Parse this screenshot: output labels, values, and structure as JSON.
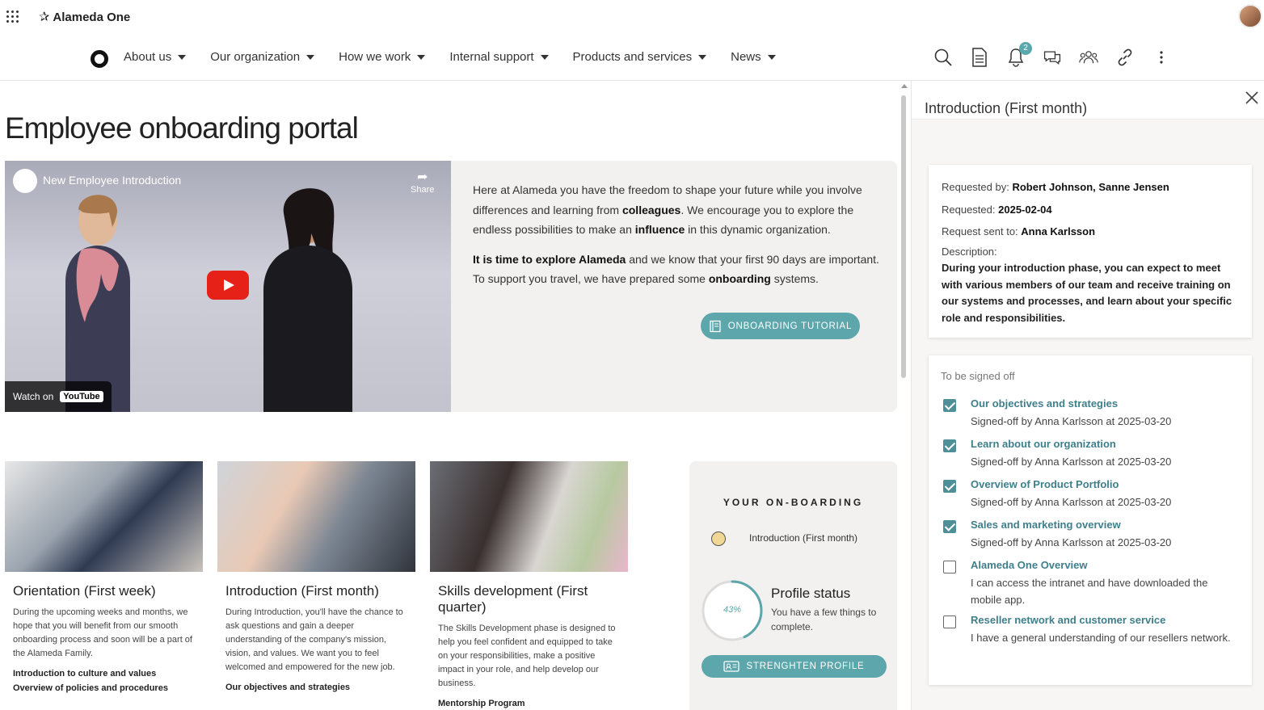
{
  "brand": {
    "name": "Alameda One"
  },
  "nav": {
    "items": [
      {
        "label": "About us"
      },
      {
        "label": "Our organization"
      },
      {
        "label": "How we work"
      },
      {
        "label": "Internal support"
      },
      {
        "label": "Products and services"
      },
      {
        "label": "News"
      }
    ],
    "icons": [
      "search-icon",
      "document-icon",
      "bell-icon",
      "chat-icon",
      "people-icon",
      "link-icon",
      "more-vertical-icon"
    ],
    "notification_count": "2"
  },
  "page": {
    "title": "Employee onboarding portal"
  },
  "video": {
    "title": "New Employee Introduction",
    "share_label": "Share",
    "watch_on": "Watch on",
    "youtube_label": "YouTube"
  },
  "hero": {
    "p1_a": "Here at Alameda you have the freedom to shape your future while you involve differences and learning from ",
    "p1_b": "colleagues",
    "p1_c": ". We encourage you to explore the endless possibilities to make an ",
    "p1_d": "influence",
    "p1_e": " in this dynamic organization.",
    "p2_a": "It is time to explore Alameda",
    "p2_b": " and we know that your first 90 days are important. To support you travel, we have prepared some ",
    "p2_c": "onboarding",
    "p2_d": " systems.",
    "tutorial_button": "ONBOARDING TUTORIAL"
  },
  "cards": [
    {
      "title": "Orientation (First week)",
      "text": "During the upcoming weeks and months, we hope that you will benefit from our smooth onboarding process and soon will be a part of the Alameda Family.",
      "links": [
        "Introduction to culture and values",
        "Overview of policies and procedures"
      ]
    },
    {
      "title": "Introduction (First month)",
      "text": "During Introduction, you'll have the chance to ask questions and gain a deeper understanding of the company's mission, vision, and values. We want you to feel welcomed and empowered for the new job.",
      "links": [
        "Our objectives and strategies"
      ]
    },
    {
      "title": "Skills development (First quarter)",
      "text": "The Skills Development phase is designed to help you feel confident and equipped to take on your responsibilities, make a positive impact in your role, and help develop our business.",
      "links": [
        "Mentorship Program"
      ]
    }
  ],
  "onboarding": {
    "title": "YOUR ON-BOARDING",
    "current_phase": "Introduction (First month)",
    "progress_percent": 43,
    "progress_label": "43%",
    "profile_title": "Profile status",
    "profile_desc": "You have a few things to complete.",
    "strengthen_button": "STRENGHTEN PROFILE"
  },
  "panel": {
    "title": "Introduction (First month)",
    "requested_by_label": "Requested by:",
    "requested_by": "Robert Johnson, Sanne Jensen",
    "requested_label": "Requested:",
    "requested": "2025-02-04",
    "sent_to_label": "Request sent to:",
    "sent_to": "Anna Karlsson",
    "description_label": "Description:",
    "description": "During your introduction phase, you can expect to meet with various members of our team and receive training on our systems and processes, and learn about your specific role and responsibilities.",
    "signoff_heading": "To be signed off",
    "items": [
      {
        "title": "Our objectives and strategies",
        "sub": "Signed-off by Anna Karlsson at 2025-03-20",
        "checked": true
      },
      {
        "title": "Learn about our organization",
        "sub": "Signed-off by Anna Karlsson at 2025-03-20",
        "checked": true
      },
      {
        "title": "Overview of Product Portfolio",
        "sub": "Signed-off by Anna Karlsson at 2025-03-20",
        "checked": true
      },
      {
        "title": "Sales and marketing overview",
        "sub": "Signed-off by Anna Karlsson at 2025-03-20",
        "checked": true
      },
      {
        "title": "Alameda One Overview",
        "sub": "I can access the intranet and have downloaded the mobile app.",
        "checked": false
      },
      {
        "title": "Reseller network and customer service",
        "sub": "I have a general understanding of our resellers network.",
        "checked": false
      }
    ]
  },
  "colors": {
    "accent": "#5ca6ac",
    "link": "#3e7f8b",
    "panel_bg": "#f7f6f5",
    "card_bg": "#f2f1ef"
  }
}
